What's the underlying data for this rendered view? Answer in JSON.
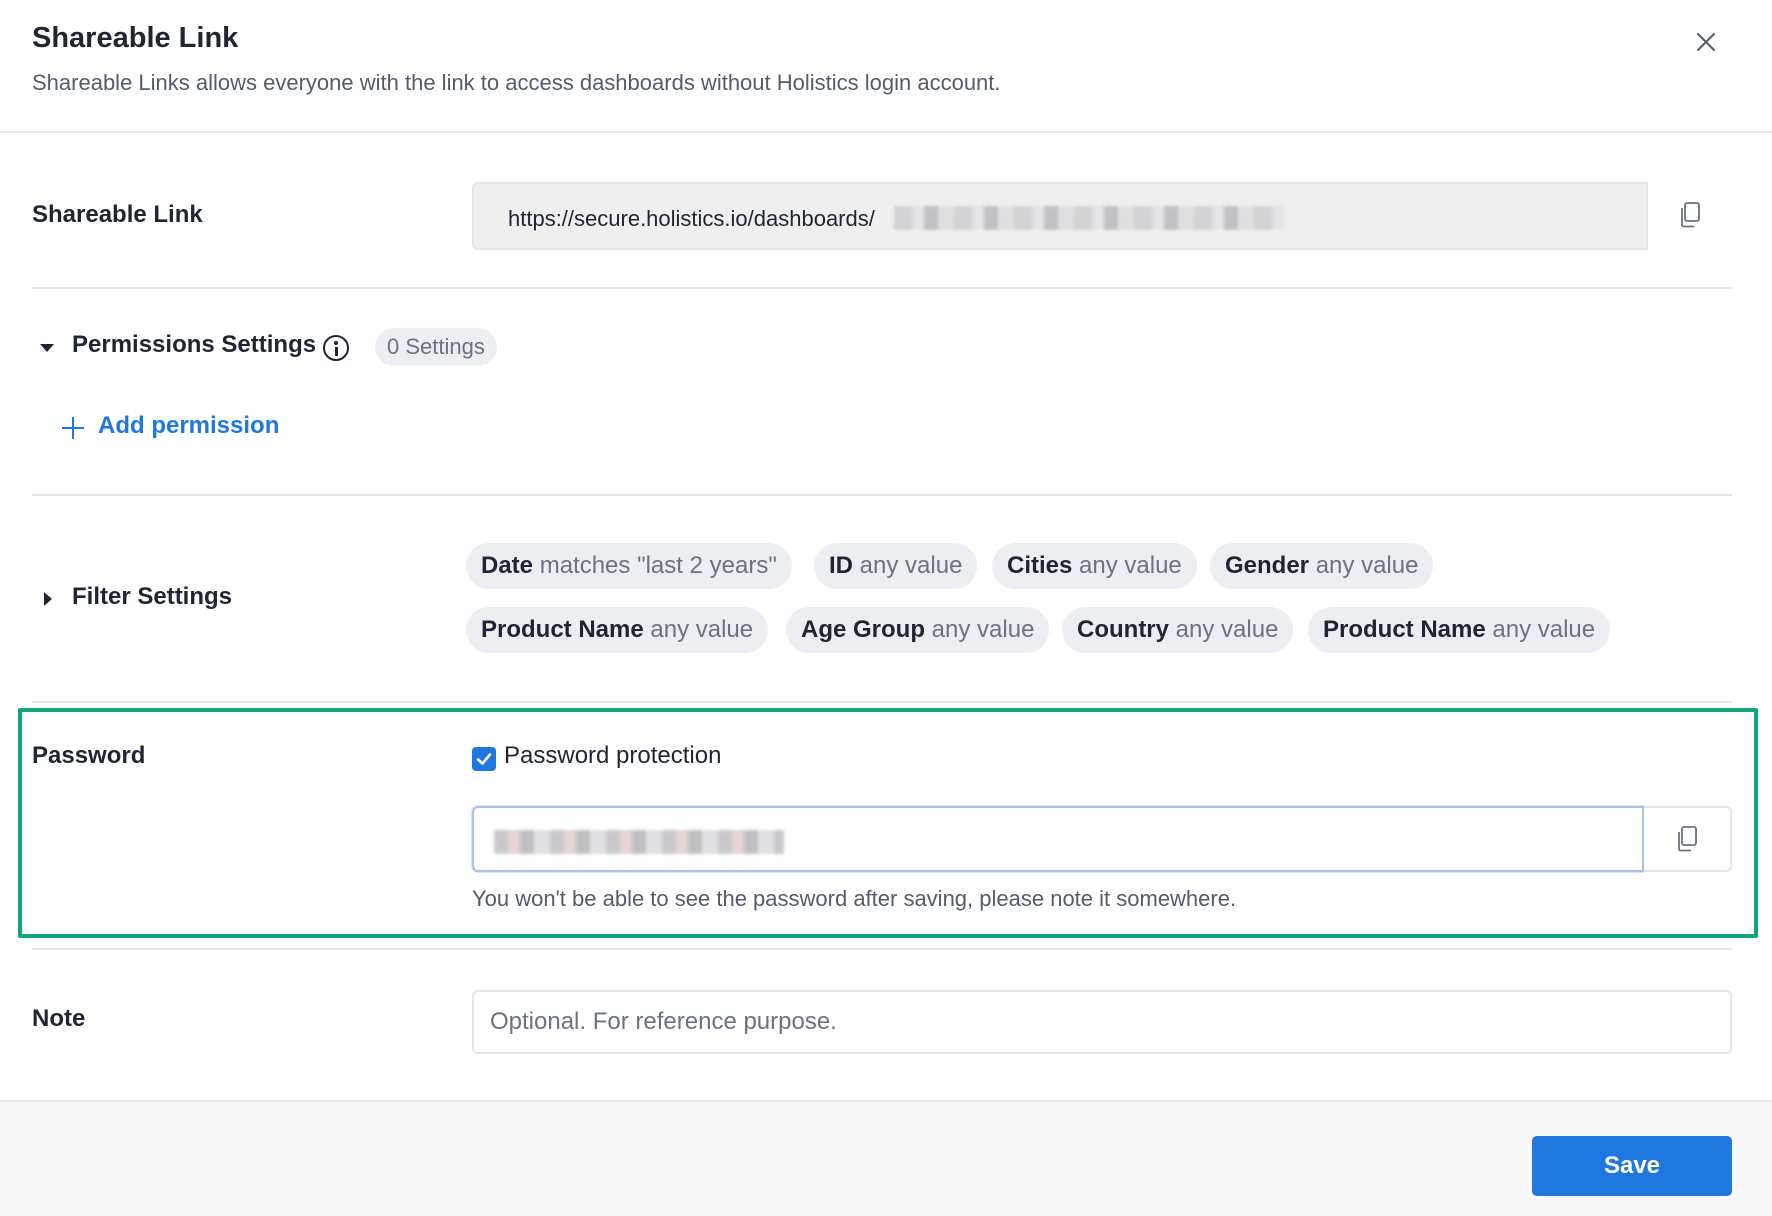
{
  "dialog": {
    "title": "Shareable Link",
    "subtitle": "Shareable Links allows everyone with the link to access dashboards without Holistics login account.",
    "close_icon": "close-icon"
  },
  "shareable_link": {
    "label": "Shareable Link",
    "url_prefix": "https://secure.holistics.io/dashboards/",
    "copy_icon": "copy-icon"
  },
  "permissions": {
    "label": "Permissions Settings",
    "count": "0 Settings",
    "add_label": "Add permission",
    "expanded": true
  },
  "filters": {
    "label": "Filter Settings",
    "expanded": false,
    "chips": [
      {
        "name": "Date",
        "value": "matches \"last 2 years\""
      },
      {
        "name": "ID",
        "value": "any value"
      },
      {
        "name": "Cities",
        "value": "any value"
      },
      {
        "name": "Gender",
        "value": "any value"
      },
      {
        "name": "Product Name",
        "value": "any value"
      },
      {
        "name": "Age Group",
        "value": "any value"
      },
      {
        "name": "Country",
        "value": "any value"
      },
      {
        "name": "Product Name",
        "value": "any value"
      }
    ]
  },
  "password": {
    "label": "Password",
    "checkbox_label": "Password protection",
    "checked": true,
    "hint": "You won't be able to see the password after saving, please note it somewhere."
  },
  "note": {
    "label": "Note",
    "placeholder": "Optional. For reference purpose."
  },
  "footer": {
    "save_label": "Save"
  },
  "colors": {
    "accent": "#1f77e0",
    "highlight": "#13a57d"
  }
}
